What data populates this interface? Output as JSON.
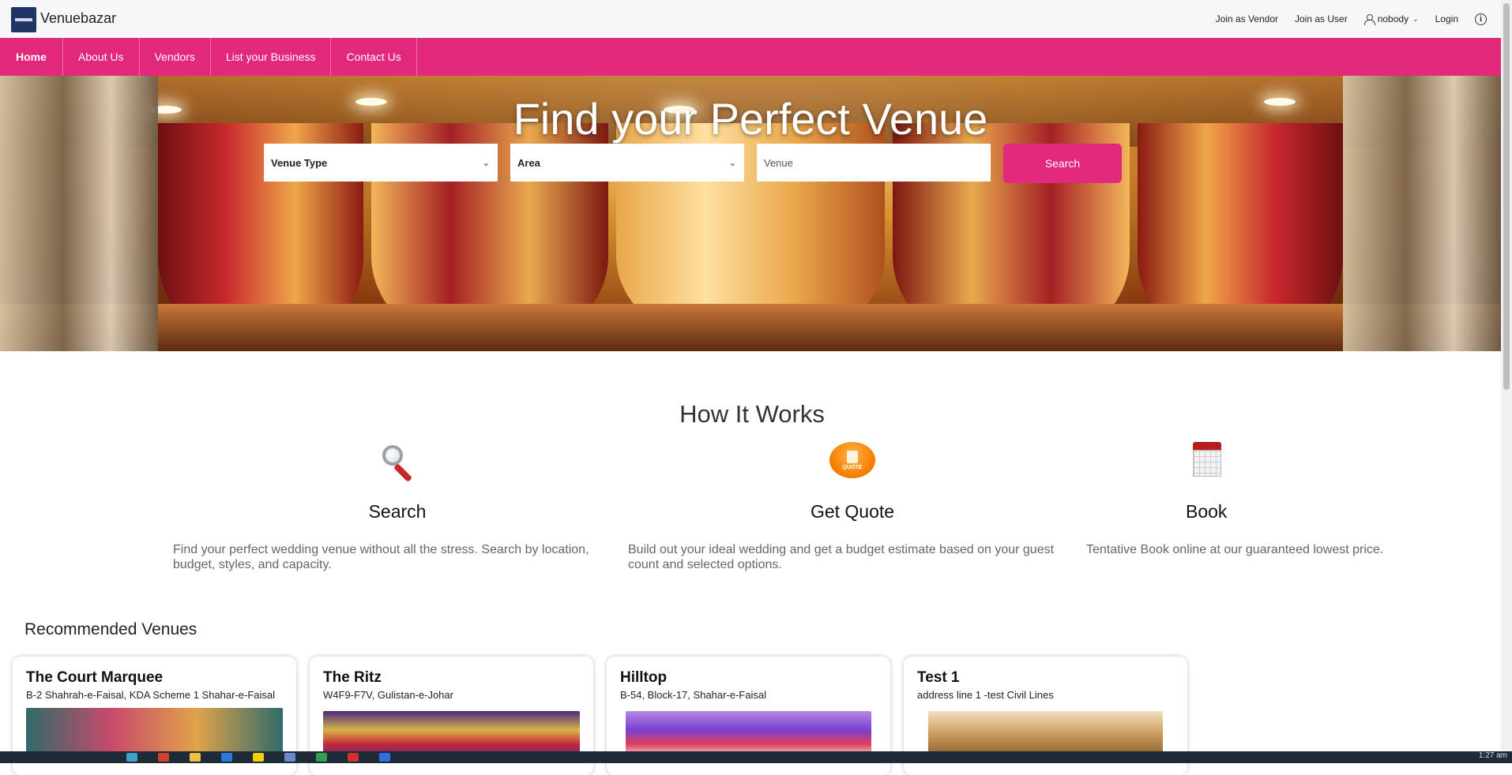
{
  "brand": {
    "name": "Venuebazar"
  },
  "topbar": {
    "join_vendor": "Join as Vendor",
    "join_user": "Join as User",
    "username": "nobody",
    "login": "Login"
  },
  "nav": {
    "items": [
      {
        "label": "Home",
        "active": true
      },
      {
        "label": "About Us"
      },
      {
        "label": "Vendors"
      },
      {
        "label": "List your Business"
      },
      {
        "label": "Contact Us"
      }
    ]
  },
  "hero": {
    "title": "Find your Perfect Venue",
    "venue_type": "Venue Type",
    "area": "Area",
    "venue_placeholder": "Venue",
    "search_label": "Search"
  },
  "how": {
    "title": "How It Works",
    "steps": [
      {
        "title": "Search",
        "icon": "magnifier-icon",
        "desc": "Find your perfect wedding venue without all the stress. Search by location, budget, styles, and capacity."
      },
      {
        "title": "Get Quote",
        "icon": "quote-icon",
        "desc": "Build out your ideal wedding and get a budget estimate based on your guest count and selected options."
      },
      {
        "title": "Book",
        "icon": "calendar-icon",
        "desc": "Tentative Book online at our guaranteed lowest price."
      }
    ],
    "quote_icon_text": "QUOTE"
  },
  "recommended": {
    "title": "Recommended Venues",
    "venues": [
      {
        "name": "The Court Marquee",
        "address": "B-2 Shahrah-e-Faisal, KDA Scheme 1 Shahar-e-Faisal"
      },
      {
        "name": "The Ritz",
        "address": "W4F9-F7V, Gulistan-e-Johar"
      },
      {
        "name": "Hilltop",
        "address": "B-54, Block-17, Shahar-e-Faisal"
      },
      {
        "name": "Test 1",
        "address": "address line 1 -test Civil Lines"
      }
    ]
  },
  "taskbar": {
    "clock": "1:27 am"
  },
  "colors": {
    "accent": "#e2287a",
    "brand_logo": "#1e3566"
  }
}
